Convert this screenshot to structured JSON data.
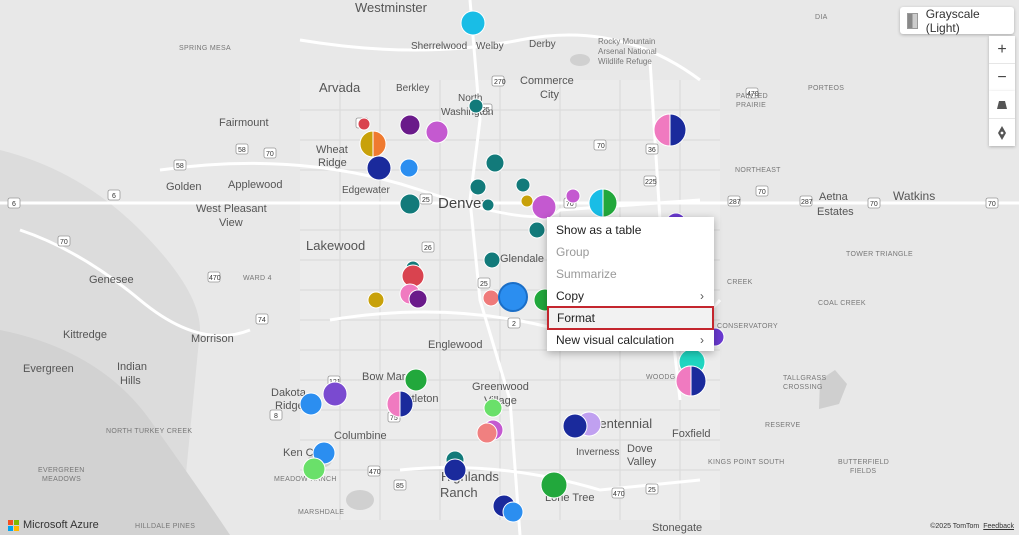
{
  "map_labels": {
    "westminster": "Westminster",
    "sherrelwood": "Sherrelwood",
    "welby": "Welby",
    "derby": "Derby",
    "rocky_mountain": "Rocky Mountain\nArsenal National\nWildlife Refuge",
    "spring_mesa": "SPRING MESA",
    "arvada": "Arvada",
    "berkley": "Berkley",
    "north_washington": "North\nWashington",
    "commerce_city": "Commerce\nCity",
    "fairmount": "Fairmount",
    "wheat_ridge": "Wheat\nRidge",
    "golden": "Golden",
    "applewood": "Applewood",
    "edgewater": "Edgewater",
    "denver": "Denver",
    "west_pleasant_view": "West Pleasant\nView",
    "lakewood": "Lakewood",
    "glendale": "Glendale",
    "genesee": "Genesee",
    "ward4": "WARD 4",
    "kittredge": "Kittredge",
    "morrison": "Morrison",
    "englewood": "Englewood",
    "evergreen": "Evergreen",
    "indian_hills": "Indian\nHills",
    "bow_mar": "Bow Mar",
    "greenwood_village": "Greenwood\nVillage",
    "dakota_ridge": "Dakota\nRidge",
    "littleton": "Littleton",
    "north_turkey_creek": "NORTH TURKEY CREEK",
    "columbine": "Columbine",
    "centennial": "Centennial",
    "foxfield": "Foxfield",
    "ken_caryl": "Ken Caryl",
    "dove_valley": "Dove\nValley",
    "inverness": "Inverness",
    "evergreen_meadows": "EVERGREEN\nMEADOWS",
    "meadow_ranch": "MEADOW RANCH",
    "highlands_ranch": "Highlands\nRanch",
    "lone_tree": "Lone Tree",
    "marshdale": "MARSHDALE",
    "hilldale_pines": "HILLDALE PINES",
    "stonegate": "Stonegate",
    "watkins": "Watkins",
    "aetna_estates": "Aetna\nEstates",
    "porteos": "PORTEOS",
    "painted_prairie": "PAINTED\nPRAIRIE",
    "northeast": "NORTHEAST",
    "tower_triangle": "TOWER TRIANGLE",
    "coal_creek": "COAL CREEK",
    "upper_creek": "CREEK",
    "conservatory": "CONSERVATORY",
    "woodgate": "WOODGATE",
    "tallgrass": "TALLGRASS\nCROSSING",
    "kings_point": "KINGS POINT SOUTH",
    "butterfield": "BUTTERFIELD\nFIELDS",
    "reserve": "RESERVE",
    "dia": "DIA"
  },
  "map_style_button": "Grayscale (Light)",
  "zoom_in": "+",
  "zoom_out": "−",
  "context_menu": {
    "show_as_table": "Show as a table",
    "group": "Group",
    "summarize": "Summarize",
    "copy": "Copy",
    "format": "Format",
    "new_visual_calculation": "New visual calculation"
  },
  "logo_text": "Microsoft Azure",
  "attribution": "©2025 TomTom",
  "feedback": "Feedback",
  "colors": {
    "teal": "#127a7a",
    "cyan": "#19bde6",
    "purple": "#6a1a8a",
    "orchid": "#c459d0",
    "navy": "#1a2a9c",
    "blue": "#2b8ef0",
    "red": "#d9434f",
    "green": "#22a83c",
    "gold": "#c8a10a",
    "pink": "#f07ac0",
    "highlight": "#c4262e"
  }
}
